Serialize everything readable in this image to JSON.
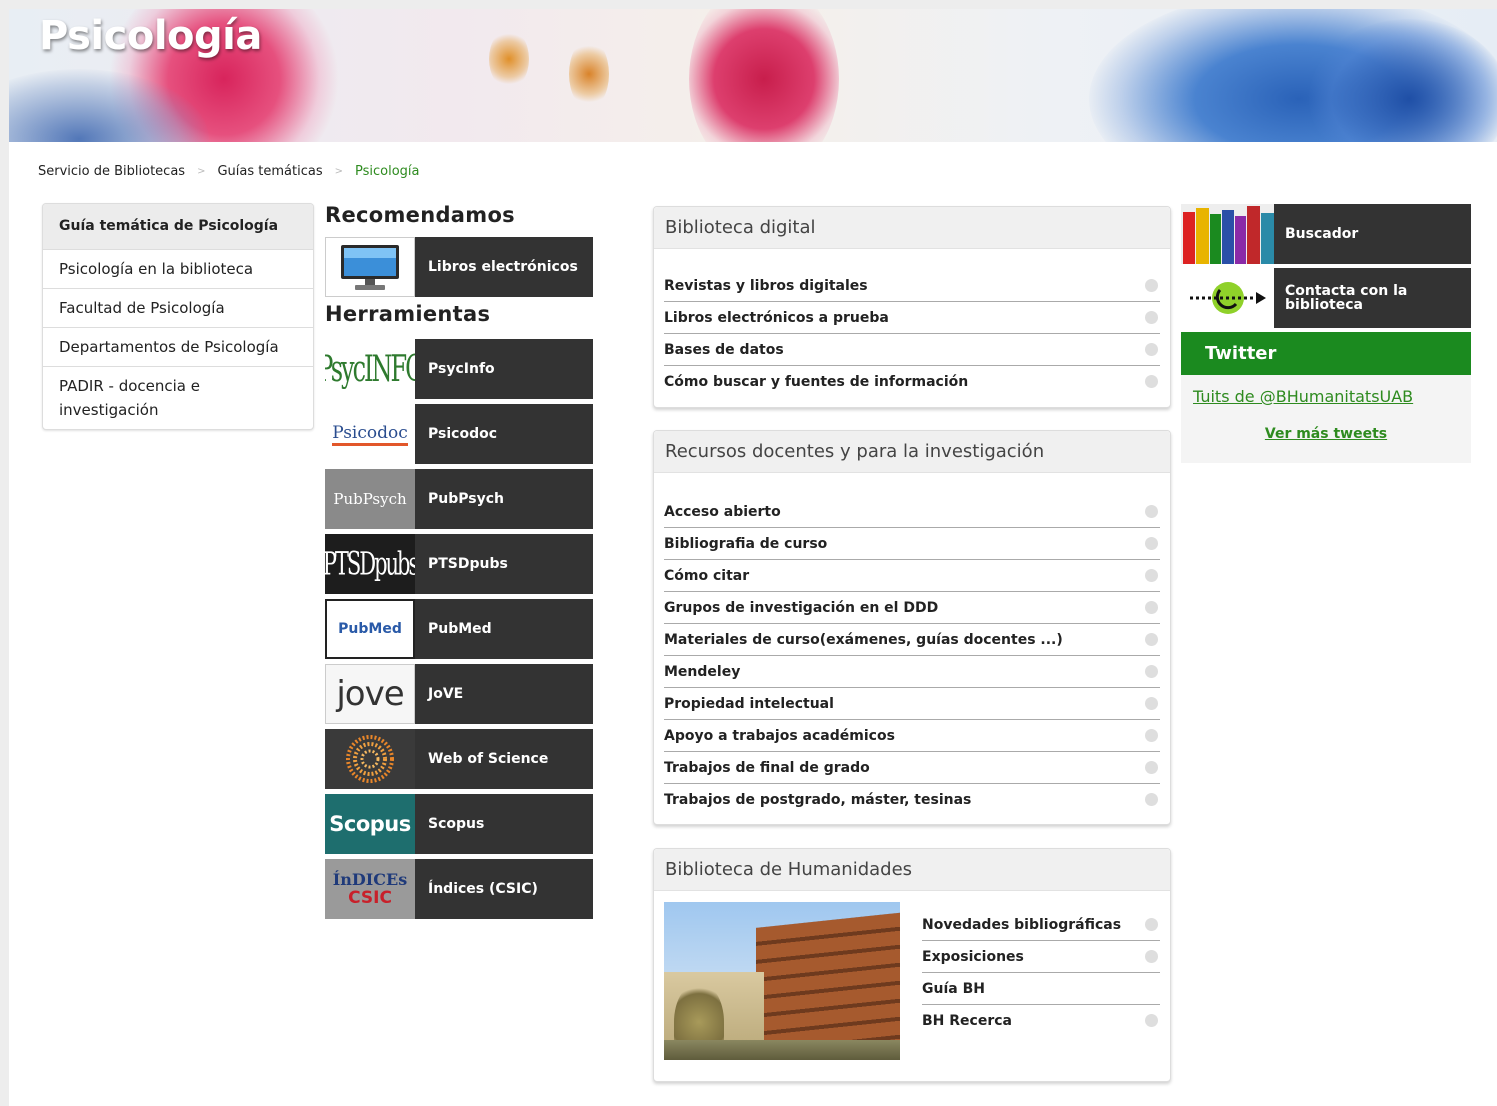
{
  "banner": {
    "title": "Psicología"
  },
  "breadcrumb": {
    "items": [
      "Servicio de Bibliotecas",
      "Guías temáticas",
      "Psicología"
    ]
  },
  "leftnav": {
    "heading": "Guía temática de Psicología",
    "items": [
      "Psicología en la biblioteca",
      "Facultad de Psicología",
      "Departamentos de Psicología",
      "PADIR - docencia e investigación"
    ]
  },
  "recommend": {
    "title": "Recomendamos",
    "tile_label": "Libros electrónicos"
  },
  "tools": {
    "title": "Herramientas",
    "tiles": [
      {
        "label": "PsycInfo",
        "logo": "PsycINFO"
      },
      {
        "label": "Psicodoc",
        "logo": "Psicodoc"
      },
      {
        "label": "PubPsych",
        "logo": "PubPsych"
      },
      {
        "label": "PTSDpubs",
        "logo": "PTSDpubs"
      },
      {
        "label": "PubMed",
        "logo": "PubMed"
      },
      {
        "label": "JoVE",
        "logo": "jove"
      },
      {
        "label": "Web of Science",
        "logo": ""
      },
      {
        "label": "Scopus",
        "logo": "Scopus"
      },
      {
        "label": "Índices (CSIC)",
        "logo": "ÍnDICEs",
        "logo2": "CSIC"
      }
    ]
  },
  "digital": {
    "title": "Biblioteca digital",
    "items": [
      "Revistas y libros digitales",
      "Libros electrónicos a prueba",
      "Bases de datos",
      "Cómo buscar y fuentes de información"
    ]
  },
  "research": {
    "title": "Recursos docentes y para la investigación",
    "items": [
      "Acceso abierto",
      "Bibliografia de curso",
      "Cómo citar",
      "Grupos de investigación en el DDD",
      "Materiales de curso(exámenes, guías docentes ...)",
      "Mendeley",
      "Propiedad intelectual",
      "Apoyo a trabajos académicos",
      "Trabajos de final de grado",
      "Trabajos de postgrado, máster, tesinas"
    ]
  },
  "humanities": {
    "title": "Biblioteca de Humanidades",
    "items": [
      "Novedades bibliográficas",
      "Exposiciones",
      "Guía BH",
      "BH Recerca"
    ]
  },
  "right": {
    "search_label": "Buscador",
    "contact_label": "Contacta con la biblioteca",
    "twitter_title": "Twitter",
    "tuits_link": "Tuits de @BHumanitatsUAB",
    "more_tweets": "Ver más tweets"
  },
  "colors": {
    "accent_green": "#1b8a1f",
    "link_green": "#2e8b1f",
    "tile_dark": "#333333"
  }
}
